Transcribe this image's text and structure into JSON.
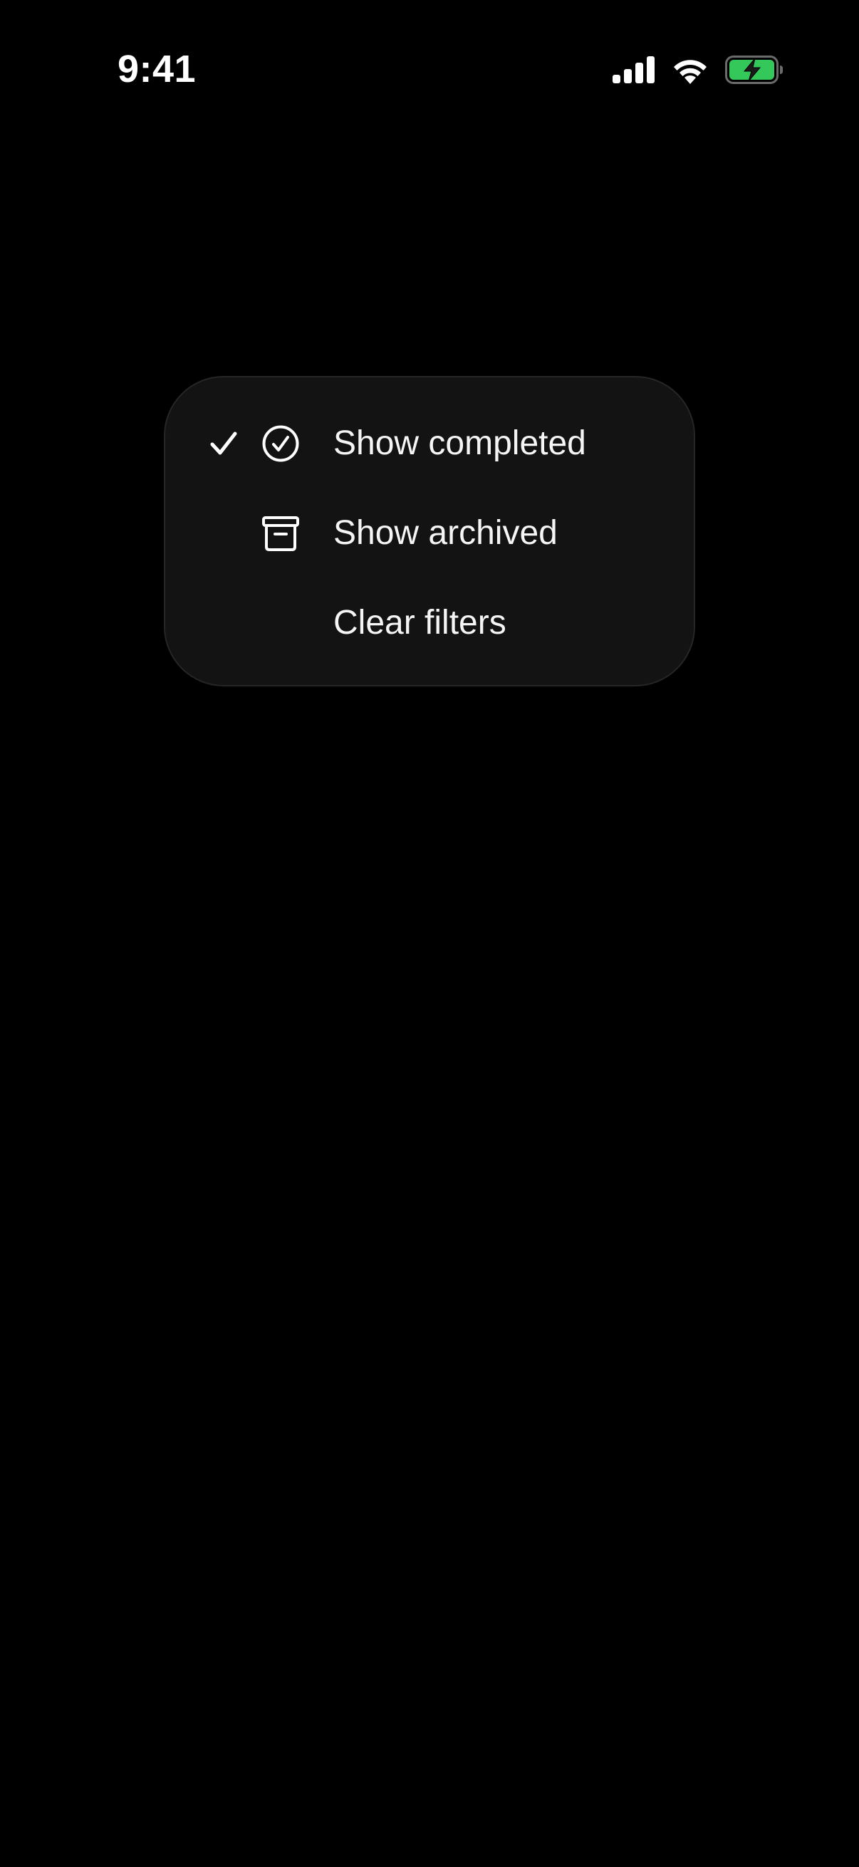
{
  "status_bar": {
    "time": "9:41",
    "icons": [
      "cellular-signal-icon",
      "wifi-icon",
      "battery-charging-icon"
    ],
    "battery_color": "#34c759"
  },
  "menu": {
    "items": [
      {
        "label": "Show completed",
        "icon": "checkmark-circle-icon",
        "checked": true
      },
      {
        "label": "Show archived",
        "icon": "archive-box-icon",
        "checked": false
      },
      {
        "label": "Clear filters",
        "icon": null,
        "checked": false
      }
    ]
  },
  "colors": {
    "background": "#000000",
    "menu_background": "#131313",
    "text": "#ffffff"
  }
}
